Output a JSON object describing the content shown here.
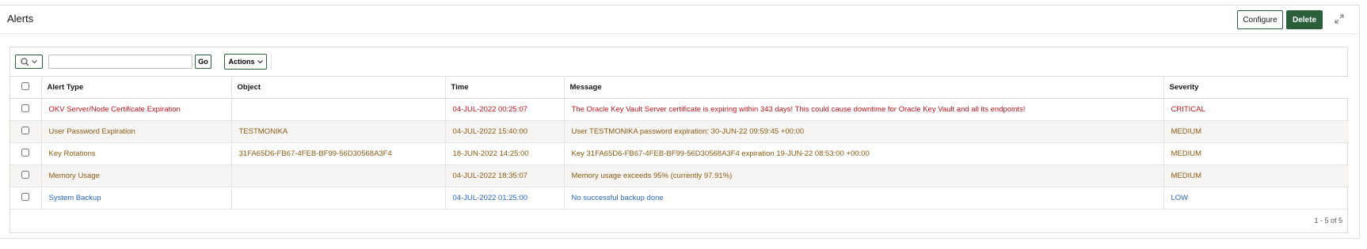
{
  "region": {
    "title": "Alerts",
    "configure_label": "Configure",
    "delete_label": "Delete"
  },
  "toolbar": {
    "search_value": "",
    "go_label": "Go",
    "actions_label": "Actions"
  },
  "table": {
    "columns": [
      "Alert Type",
      "Object",
      "Time",
      "Message",
      "Severity"
    ],
    "rows": [
      {
        "alert_type": "OKV Server/Node Certificate Expiration",
        "object": "",
        "time": "04-JUL-2022 00:25:07",
        "message": "The Oracle Key Vault Server certificate is expiring within 343 days! This could cause downtime for Oracle Key Vault and all its endpoints!",
        "severity": "CRITICAL",
        "color": "#c0141b"
      },
      {
        "alert_type": "User Password Expiration",
        "object": "TESTMONIKA",
        "time": "04-JUL-2022 15:40:00",
        "message": "User TESTMONIKA password expiration: 30-JUN-22 09:59:45 +00:00",
        "severity": "MEDIUM",
        "color": "#8a5a10"
      },
      {
        "alert_type": "Key Rotations",
        "object": "31FA65D6-FB67-4FEB-BF99-56D30568A3F4",
        "time": "18-JUN-2022 14:25:00",
        "message": "Key 31FA65D6-FB67-4FEB-BF99-56D30568A3F4 expiration 19-JUN-22 08:53:00 +00:00",
        "severity": "MEDIUM",
        "color": "#8a5a10"
      },
      {
        "alert_type": "Memory Usage",
        "object": "",
        "time": "04-JUL-2022 18:35:07",
        "message": "Memory usage exceeds 95% (currently 97.91%)",
        "severity": "MEDIUM",
        "color": "#8a5a10"
      },
      {
        "alert_type": "System Backup",
        "object": "",
        "time": "04-JUL-2022 01:25:00",
        "message": "No successful backup done",
        "severity": "LOW",
        "color": "#2a64c9"
      }
    ]
  },
  "pagination": "1 - 5 of 5",
  "icons": {
    "search": "search-icon",
    "chevron": "chevron-down-icon",
    "expand": "expand-icon"
  }
}
